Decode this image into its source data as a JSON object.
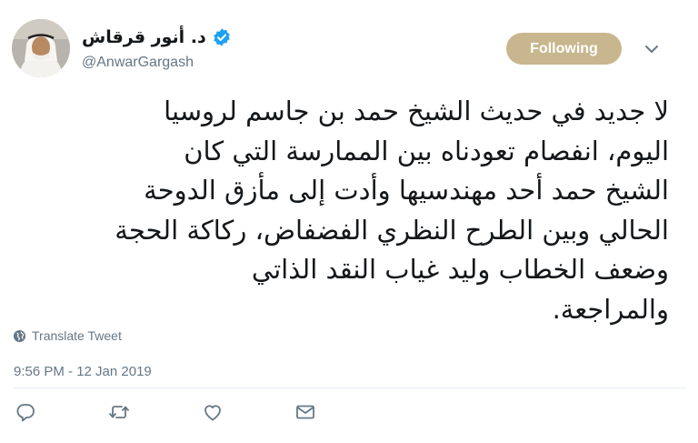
{
  "user": {
    "display_name": "د. أنور قرقاش",
    "handle": "@AnwarGargash",
    "verified": true,
    "avatar_icon": "profile-photo"
  },
  "follow_button": {
    "label": "Following",
    "color": "#c8b78e"
  },
  "caret_icon": "chevron-down-icon",
  "tweet": {
    "lines": [
      "لا جديد في حديث الشيخ حمد بن جاسم لروسيا",
      "اليوم، انفصام تعودناه بين الممارسة التي كان",
      "الشيخ حمد أحد مهندسيها وأدت إلى مأزق الدوحة",
      "الحالي وبين الطرح النظري الفضفاض، ركاكة الحجة",
      "وضعف الخطاب وليد غياب النقد الذاتي",
      "والمراجعة."
    ]
  },
  "translate_label": "Translate Tweet",
  "timestamp": "9:56 PM - 12 Jan 2019",
  "actions": [
    {
      "name": "reply",
      "icon": "reply-icon"
    },
    {
      "name": "retweet",
      "icon": "retweet-icon"
    },
    {
      "name": "like",
      "icon": "heart-icon"
    },
    {
      "name": "direct-message",
      "icon": "envelope-icon"
    }
  ],
  "colors": {
    "text": "#14171a",
    "secondary": "#657786",
    "verified": "#1da1f2",
    "divider": "#e6ecf0"
  }
}
